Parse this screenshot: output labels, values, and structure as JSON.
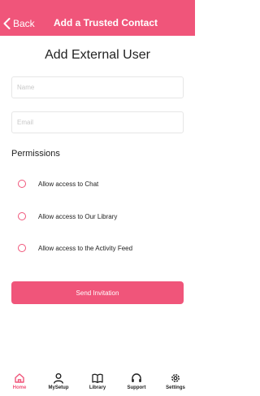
{
  "header": {
    "back_label": "Back",
    "title": "Add a Trusted Contact",
    "background_color": "#f0557a"
  },
  "page_title": "Add External User",
  "form": {
    "name_placeholder": "Name",
    "name_value": "",
    "email_placeholder": "Email",
    "email_value": ""
  },
  "permissions": {
    "title": "Permissions",
    "items": [
      {
        "label": "Allow access to Chat",
        "checked": false
      },
      {
        "label": "Allow access to Our Library",
        "checked": false
      },
      {
        "label": "Allow access to the Activity Feed",
        "checked": false
      }
    ]
  },
  "send_button_label": "Send Invitation",
  "tabbar": {
    "active": "Home",
    "items": [
      {
        "label": "Home",
        "icon": "home-icon"
      },
      {
        "label": "MySetup",
        "icon": "person-icon"
      },
      {
        "label": "Library",
        "icon": "book-icon"
      },
      {
        "label": "Support",
        "icon": "headset-icon"
      },
      {
        "label": "Settings",
        "icon": "gear-icon"
      }
    ]
  },
  "colors": {
    "accent": "#f0557a",
    "text": "#222222"
  }
}
